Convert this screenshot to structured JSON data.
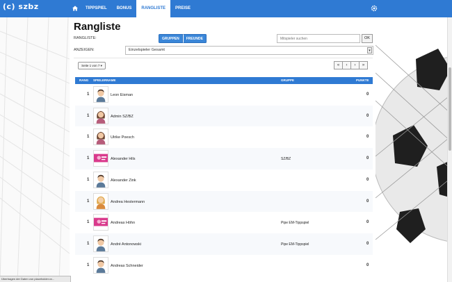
{
  "app": {
    "brand": "(c) szbz"
  },
  "nav": {
    "items": [
      {
        "label": "TIPPSPIEL"
      },
      {
        "label": "BONUS"
      },
      {
        "label": "RANGLISTE",
        "active": true
      },
      {
        "label": "PREISE"
      }
    ]
  },
  "page": {
    "title": "Rangliste",
    "rangliste_label": "RANGLISTE:",
    "anzeigen_label": "ANZEIGEN:",
    "segment": [
      "GRUPPEN",
      "FREUNDE"
    ],
    "search": {
      "placeholder": "Mitspieler suchen",
      "button": "OK"
    },
    "select": {
      "value": "Einzelspieler Gesamt"
    },
    "jump_button": "Seite 1 von 7 ▾",
    "pager": [
      "«",
      "‹",
      "›",
      "»"
    ]
  },
  "table": {
    "headers": {
      "rank": "RANG",
      "name": "SPIELERNAME",
      "group": "GRUPPE",
      "points": "PUNKTE"
    },
    "rows": [
      {
        "rank": "1",
        "name": "Leon Eisman",
        "group": "",
        "points": "0",
        "avatar": "man-icon"
      },
      {
        "rank": "1",
        "name": "Admin SZ/BZ",
        "group": "",
        "points": "0",
        "avatar": "woman-icon"
      },
      {
        "rank": "1",
        "name": "Ulrike Poesch",
        "group": "",
        "points": "0",
        "avatar": "woman-icon"
      },
      {
        "rank": "1",
        "name": "Alexander Hils",
        "group": "SZ/BZ",
        "points": "0",
        "avatar": "pink-photo-icon"
      },
      {
        "rank": "1",
        "name": "Alexander Zink",
        "group": "",
        "points": "0",
        "avatar": "man-icon"
      },
      {
        "rank": "1",
        "name": "Andrea Hestermann",
        "group": "",
        "points": "0",
        "avatar": "blonde-icon"
      },
      {
        "rank": "1",
        "name": "Andreas Höhn",
        "group": "Pipe EM-Tippspiel",
        "points": "0",
        "avatar": "pink-photo-icon"
      },
      {
        "rank": "1",
        "name": "André Antonowski",
        "group": "Pipe EM-Tippspiel",
        "points": "0",
        "avatar": "man-icon"
      },
      {
        "rank": "1",
        "name": "Andreas Schneider",
        "group": "",
        "points": "0",
        "avatar": "man-icon"
      }
    ]
  },
  "status": {
    "text": "Übertragen der Daten von placeholder.xx..."
  }
}
